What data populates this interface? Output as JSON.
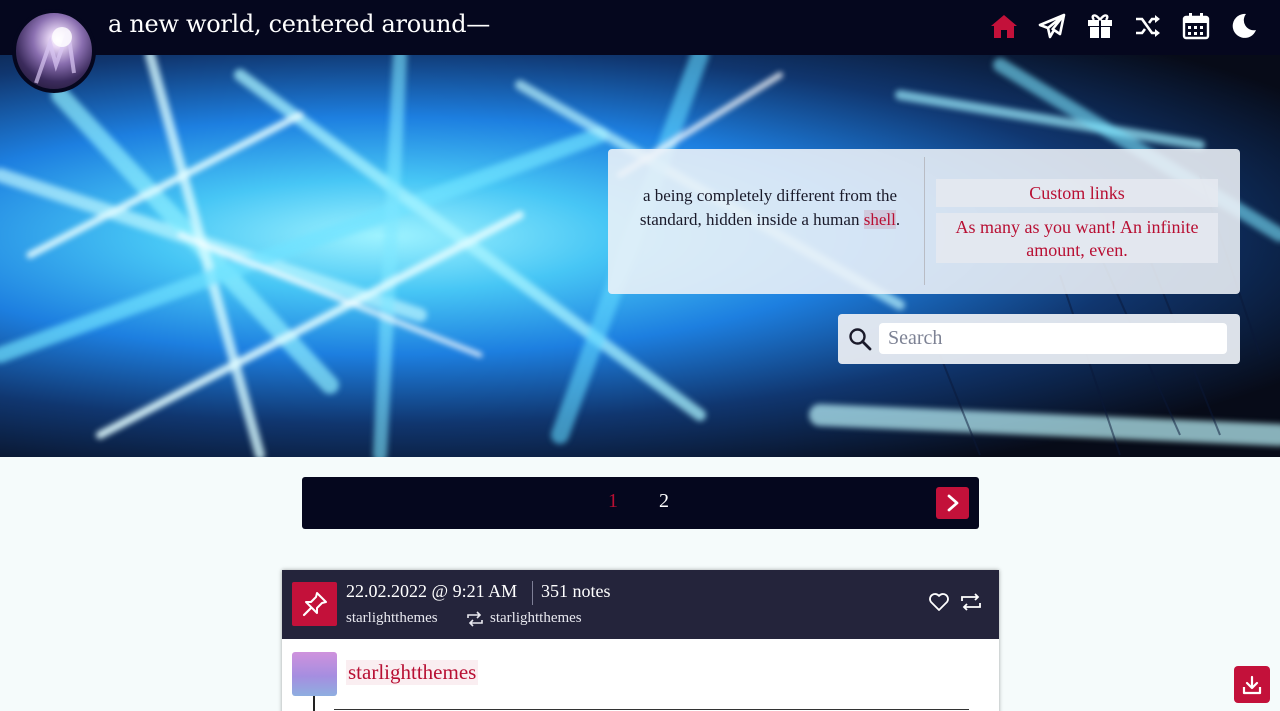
{
  "header": {
    "title": "a new world, centered around—",
    "nav_icons": [
      "home-icon",
      "send-icon",
      "gift-icon",
      "shuffle-icon",
      "calendar-icon",
      "moon-icon"
    ],
    "active_color": "#c3113a"
  },
  "description": {
    "text_before": "a being completely different from the standard, hidden inside a human ",
    "link_text": "shell",
    "text_after": "."
  },
  "custom_links": {
    "title": "Custom links",
    "body": "As many as you want! An infinite amount, even."
  },
  "search": {
    "placeholder": "Search"
  },
  "pagination": {
    "pages": [
      "1",
      "2"
    ],
    "current": "1"
  },
  "post": {
    "date": "22.02.2022 @ 9:21 AM",
    "notes": "351 notes",
    "reblogged_from": "starlightthemes",
    "original_poster": "starlightthemes",
    "author": "starlightthemes"
  },
  "colors": {
    "accent": "#c3113a",
    "navy": "#05071e",
    "post_header": "#24243b",
    "page_bg": "#f5fbfb"
  }
}
